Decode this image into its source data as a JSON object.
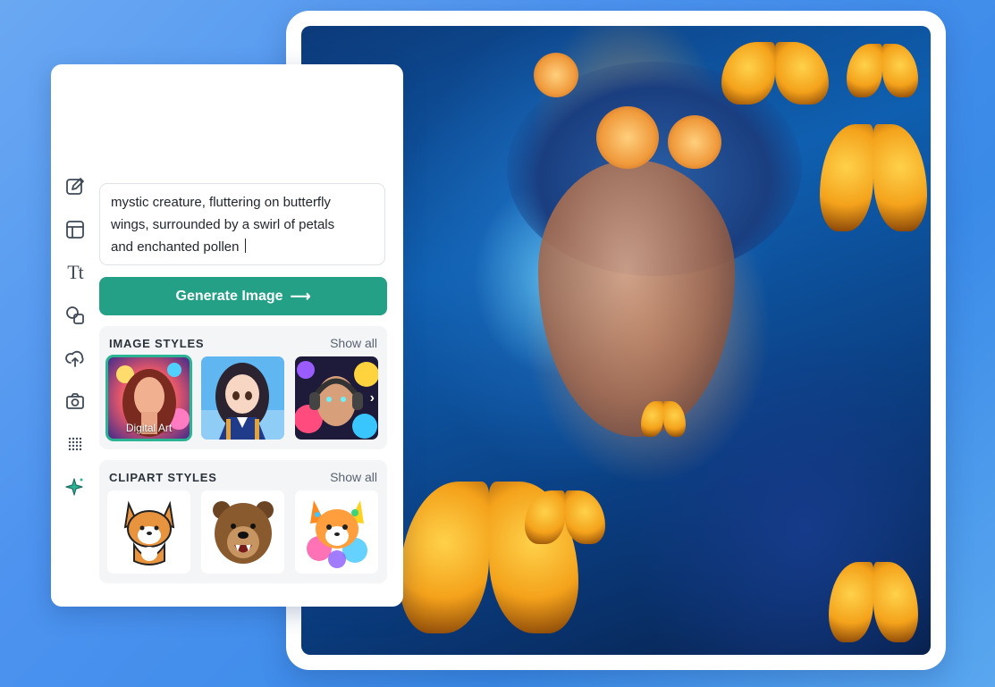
{
  "prompt": {
    "lines": [
      "mystic creature, fluttering on butterfly",
      "wings, surrounded by a swirl of petals",
      "and enchanted pollen"
    ]
  },
  "generate_button": {
    "label": "Generate Image",
    "arrow": "⟶"
  },
  "toolbar": {
    "items": [
      {
        "icon": "edit-icon"
      },
      {
        "icon": "layout-icon"
      },
      {
        "icon": "text-icon",
        "glyph": "Tt"
      },
      {
        "icon": "shapes-icon"
      },
      {
        "icon": "upload-icon"
      },
      {
        "icon": "camera-icon"
      },
      {
        "icon": "pattern-icon"
      },
      {
        "icon": "sparkle-icon"
      }
    ]
  },
  "image_styles": {
    "title": "IMAGE STYLES",
    "show_all": "Show all",
    "items": [
      {
        "label": "Digital Art",
        "selected": true
      },
      {
        "label": ""
      },
      {
        "label": ""
      }
    ],
    "next_glyph": "›"
  },
  "clipart_styles": {
    "title": "CLIPART STYLES",
    "show_all": "Show all",
    "items": [
      {
        "icon": "corgi-cartoon-icon"
      },
      {
        "icon": "bear-head-icon"
      },
      {
        "icon": "colorful-corgi-icon"
      }
    ]
  },
  "colors": {
    "accent": "#23a085",
    "selection": "#2bb494",
    "background": "#4d93ef"
  }
}
